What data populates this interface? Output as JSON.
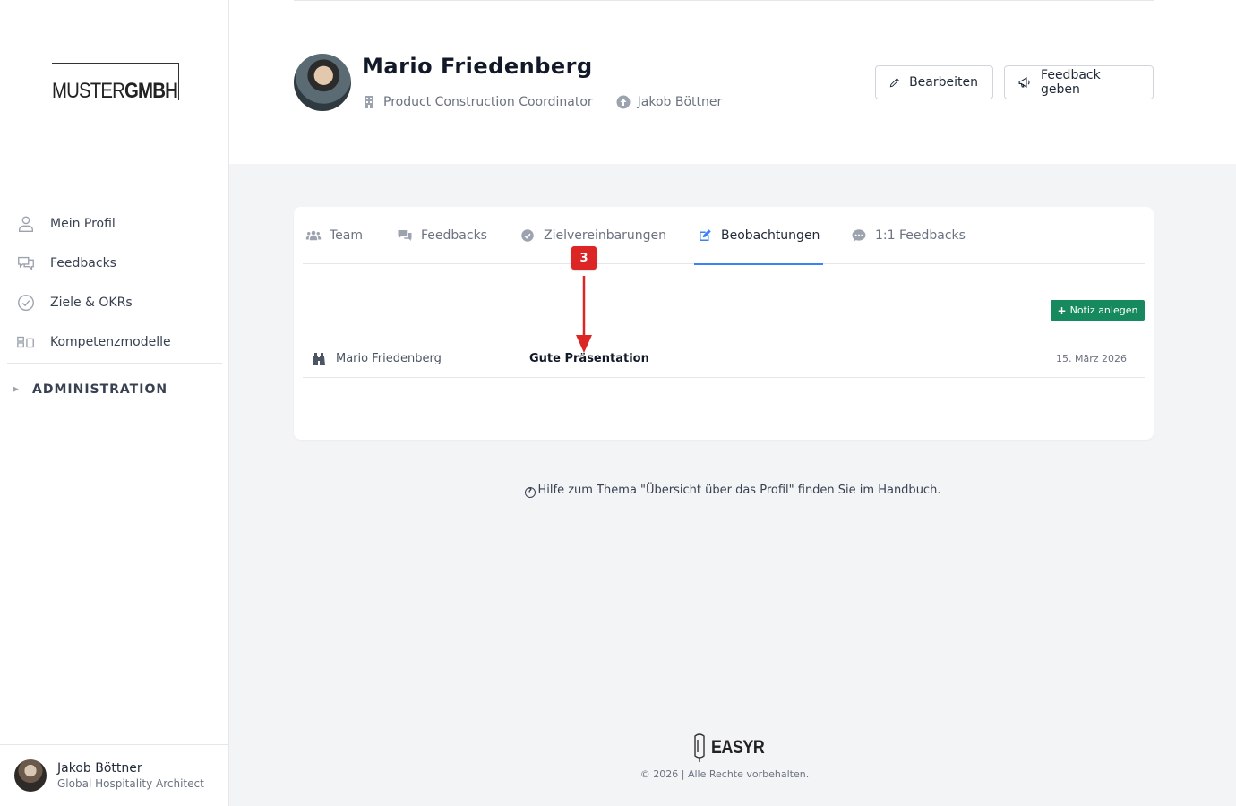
{
  "logo": {
    "light": "MUSTER",
    "bold": "GMBH"
  },
  "sidebar": {
    "items": [
      {
        "label": "Mein Profil",
        "icon": "user-icon"
      },
      {
        "label": "Feedbacks",
        "icon": "chat-bubbles-icon"
      },
      {
        "label": "Ziele & OKRs",
        "icon": "check-circle-icon"
      },
      {
        "label": "Kompetenzmodelle",
        "icon": "blocks-icon"
      }
    ],
    "admin_label": "ADMINISTRATION"
  },
  "current_user": {
    "name": "Jakob Böttner",
    "role": "Global Hospitality Architect"
  },
  "profile": {
    "name": "Mario Friedenberg",
    "position": "Product Construction Coordinator",
    "manager": "Jakob Böttner"
  },
  "actions": {
    "edit": "Bearbeiten",
    "feedback": "Feedback geben"
  },
  "tabs": [
    {
      "label": "Team",
      "icon": "users-icon"
    },
    {
      "label": "Feedbacks",
      "icon": "comments-icon"
    },
    {
      "label": "Zielvereinbarungen",
      "icon": "check-circle-icon"
    },
    {
      "label": "Beobachtungen",
      "icon": "edit-icon",
      "active": true
    },
    {
      "label": "1:1 Feedbacks",
      "icon": "comment-dots-icon"
    }
  ],
  "add_note_label": "Notiz anlegen",
  "observations": [
    {
      "author": "Mario Friedenberg",
      "title": "Gute Präsentation",
      "date": "15. März 2026"
    }
  ],
  "annotation": {
    "step": "3",
    "color": "#dc2626"
  },
  "help_text": "Hilfe zum Thema \"Übersicht über das Profil\" finden Sie im Handbuch.",
  "footer": {
    "brand": "EASYR",
    "copyright": "© 2026 | Alle Rechte vorbehalten."
  },
  "colors": {
    "accent": "#3b82f6",
    "primary_button": "#168a5e"
  }
}
